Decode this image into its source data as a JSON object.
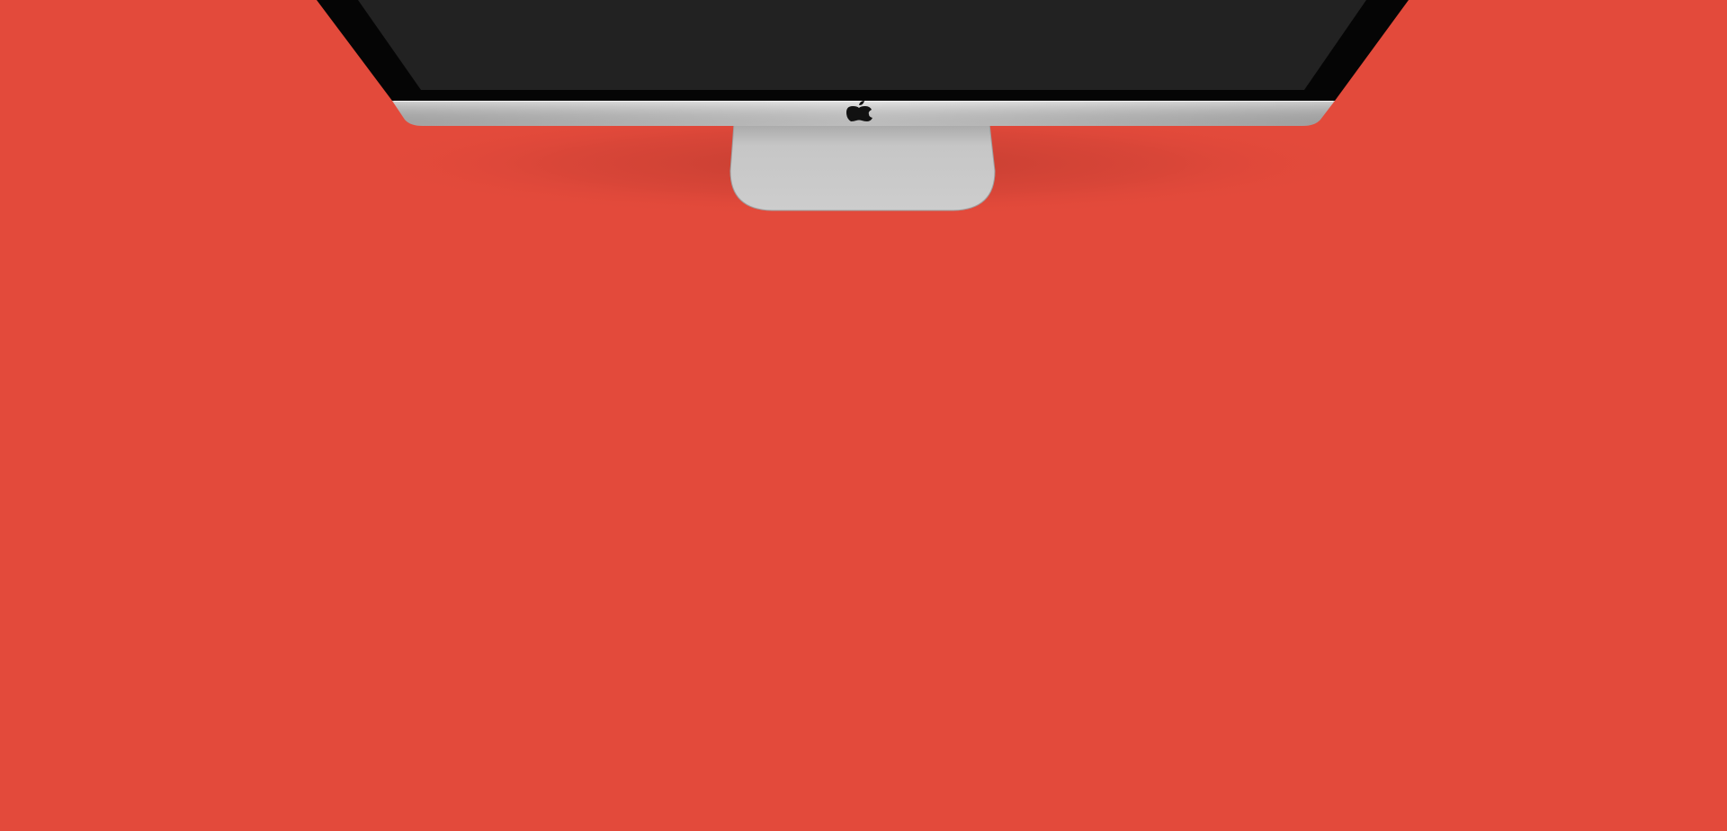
{
  "scene": {
    "background_color": "#e34a3b",
    "bezel_color": "#050505",
    "screen_color": "#222222",
    "chin_color": "#c4c4c4",
    "stand_color": "#c7c7c7",
    "logo_icon": "apple-logo-icon"
  }
}
